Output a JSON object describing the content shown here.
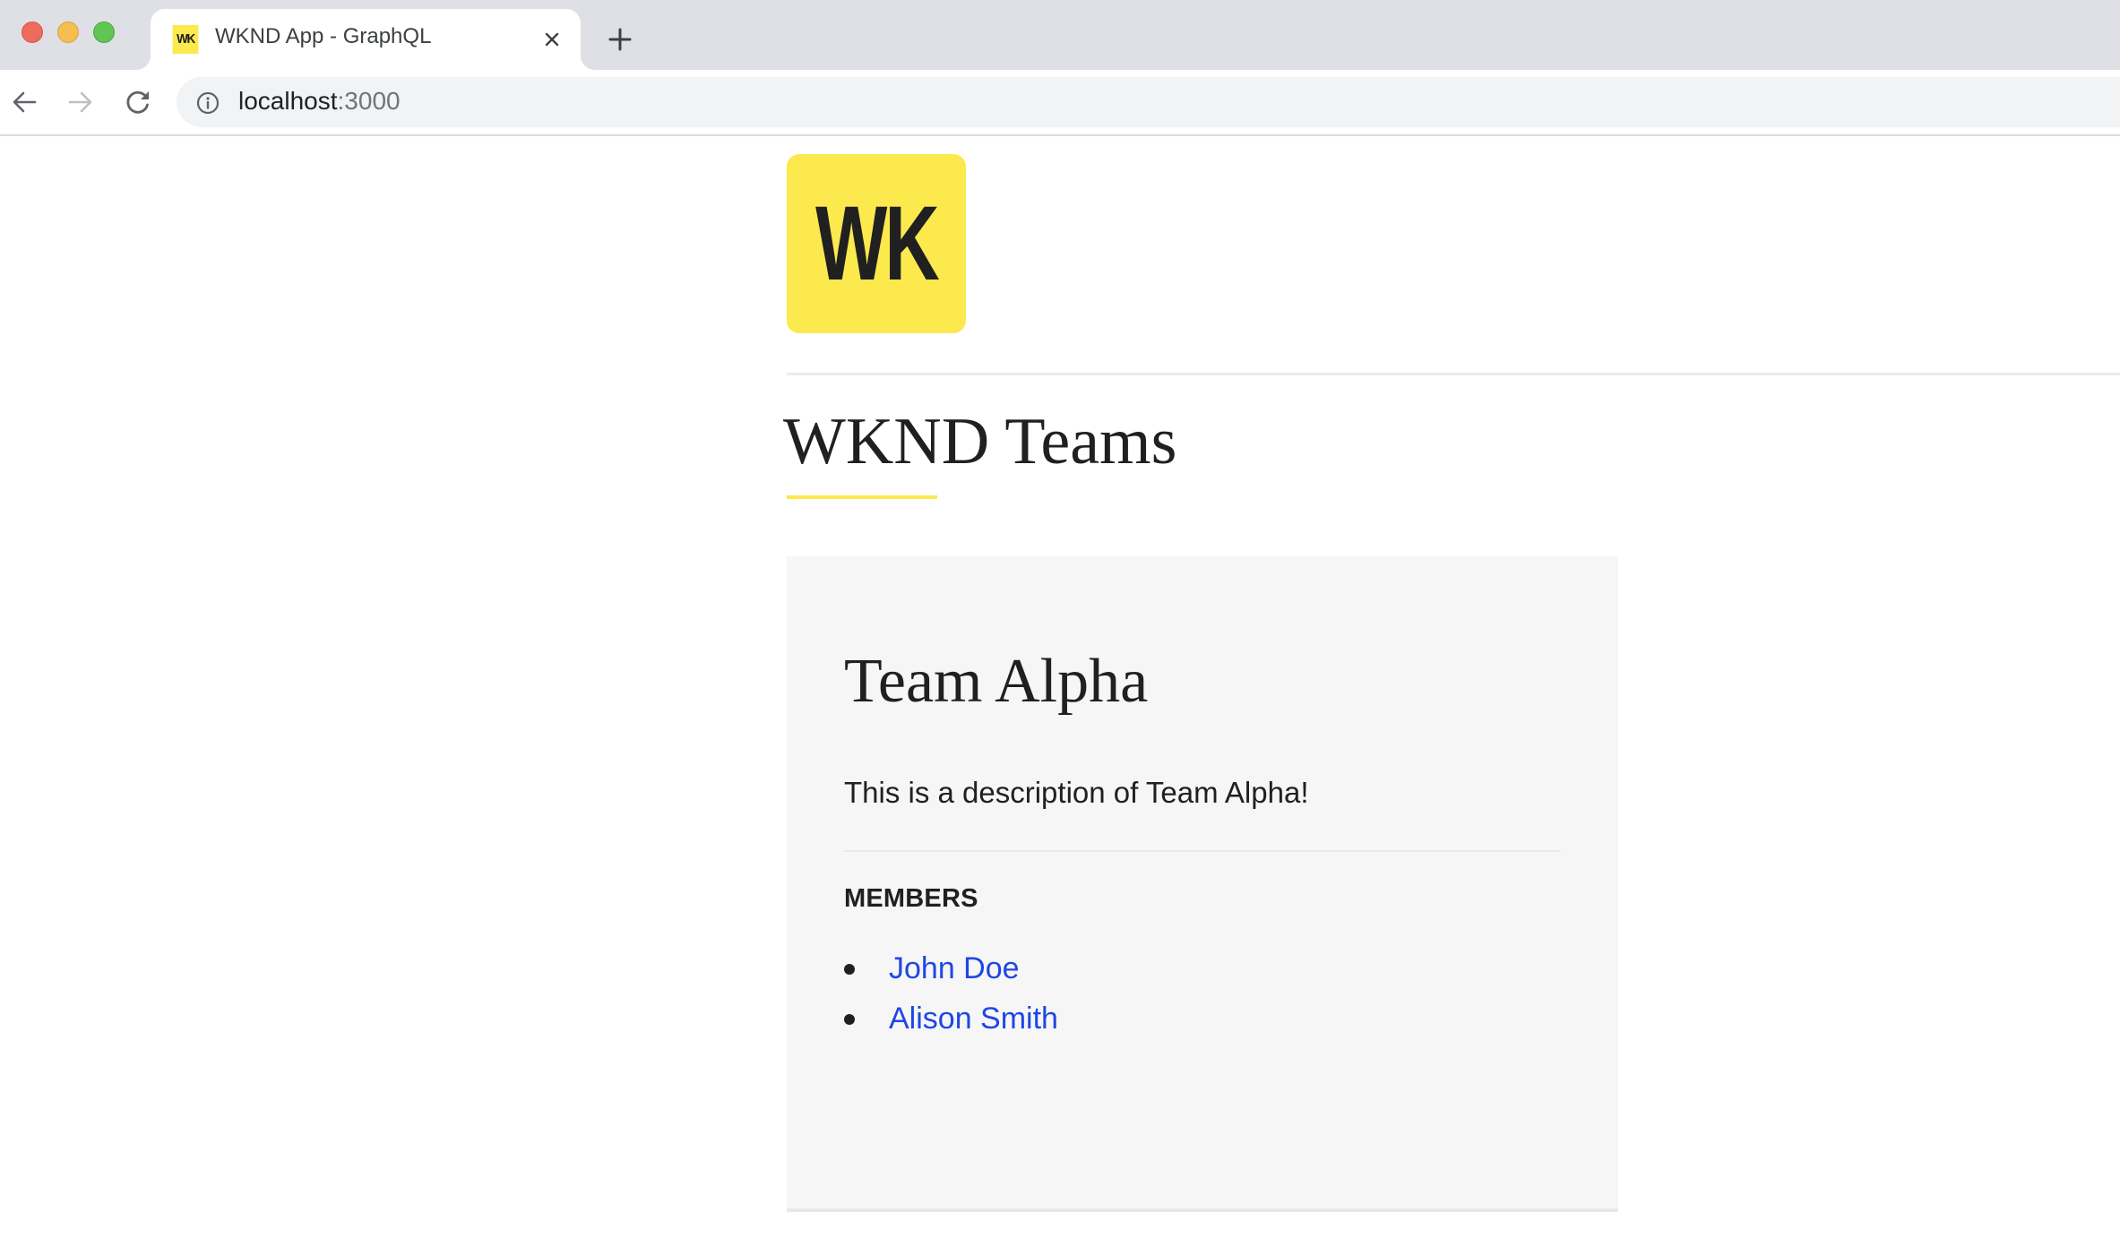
{
  "browser": {
    "tab": {
      "favicon_text": "WK",
      "title": "WKND App - GraphQL",
      "close_icon": "close-icon"
    },
    "new_tab_icon": "plus-icon",
    "nav": {
      "back_icon": "arrow-left-icon",
      "forward_icon": "arrow-right-icon",
      "reload_icon": "reload-icon"
    },
    "address_bar": {
      "info_icon": "info-icon",
      "host": "localhost",
      "port": ":3000"
    }
  },
  "page": {
    "logo_text": "WK",
    "title": "WKND Teams",
    "teams": [
      {
        "name": "Team Alpha",
        "description": "This is a description of Team Alpha!",
        "members_heading": "MEMBERS",
        "members": [
          {
            "name": "John Doe"
          },
          {
            "name": "Alison Smith"
          }
        ]
      }
    ]
  },
  "colors": {
    "brand_yellow": "#fbe94e",
    "link_blue": "#1e46e6",
    "card_background": "#f6f6f6",
    "text_dark": "#202020"
  }
}
